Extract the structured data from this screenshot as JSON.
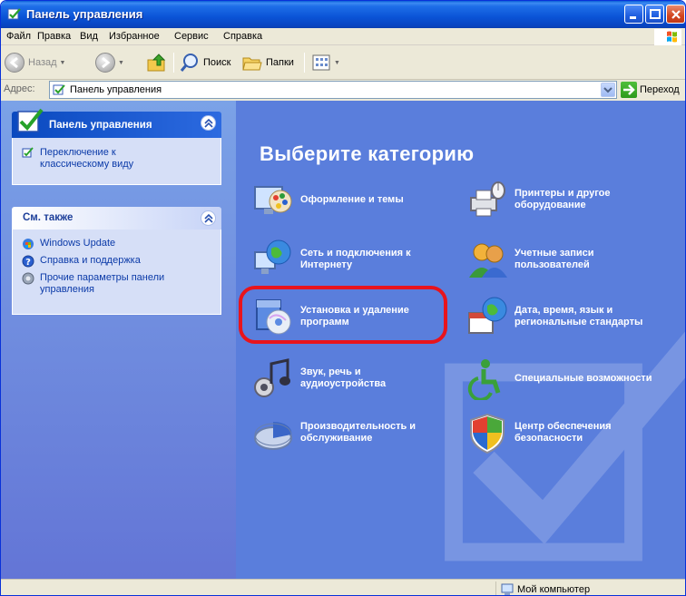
{
  "window": {
    "title": "Панель управления"
  },
  "menu": [
    {
      "label": "Файл"
    },
    {
      "label": "Правка"
    },
    {
      "label": "Вид"
    },
    {
      "label": "Избранное"
    },
    {
      "label": "Сервис"
    },
    {
      "label": "Справка"
    }
  ],
  "toolbar": {
    "back_label": "Назад",
    "search_label": "Поиск",
    "folders_label": "Папки"
  },
  "address": {
    "label": "Адрес:",
    "value": "Панель управления",
    "go_label": "Переход"
  },
  "sidebar": {
    "panel_title": "Панель управления",
    "switch_view": "Переключение к\nклассическому виду",
    "see_also_title": "См. также",
    "see_also": [
      {
        "label": "Windows Update",
        "icon": "windows-update-icon"
      },
      {
        "label": "Справка и поддержка",
        "icon": "help-icon"
      },
      {
        "label": "Прочие параметры панели\nуправления",
        "icon": "other-options-icon"
      }
    ]
  },
  "main": {
    "heading": "Выберите категорию",
    "categories": [
      {
        "label": "Оформление и темы",
        "icon": "appearance-themes-icon"
      },
      {
        "label": "Принтеры и другое\nоборудование",
        "icon": "printers-hardware-icon"
      },
      {
        "label": "Сеть и подключения к\nИнтернету",
        "icon": "network-internet-icon"
      },
      {
        "label": "Учетные записи\nпользователей",
        "icon": "user-accounts-icon"
      },
      {
        "label": "Установка и удаление\nпрограмм",
        "icon": "add-remove-programs-icon"
      },
      {
        "label": "Дата, время, язык и\nрегиональные стандарты",
        "icon": "date-time-language-icon"
      },
      {
        "label": "Звук, речь и\nаудиоустройства",
        "icon": "sound-speech-icon"
      },
      {
        "label": "Специальные возможности",
        "icon": "accessibility-icon"
      },
      {
        "label": "Производительность и\nобслуживание",
        "icon": "performance-maintenance-icon"
      },
      {
        "label": "Центр обеспечения\nбезопасности",
        "icon": "security-center-icon"
      }
    ]
  },
  "status": {
    "zone": "Мой компьютер"
  },
  "colors": {
    "highlight": "#e8141c",
    "main_bg": "#5a7edc"
  }
}
